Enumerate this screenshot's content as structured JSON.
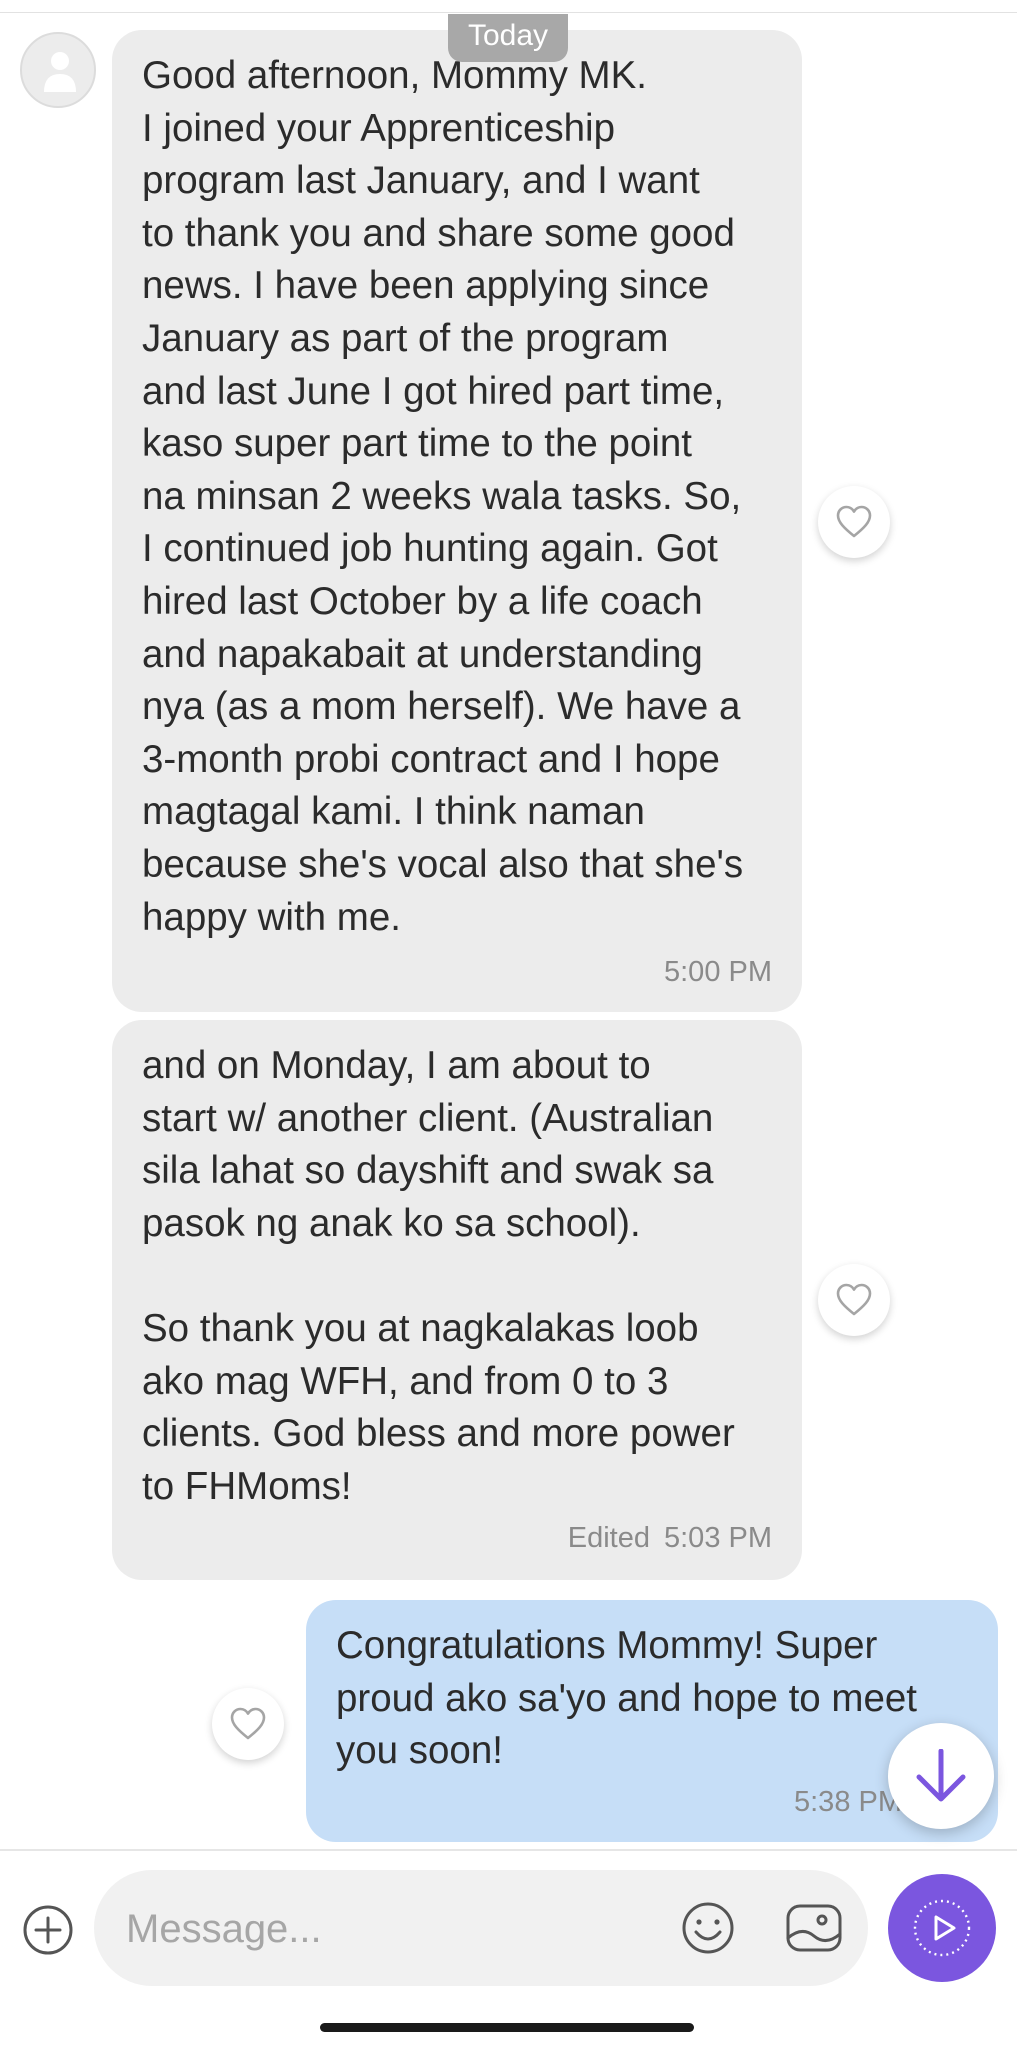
{
  "colors": {
    "incoming_bubble": "#ececec",
    "outgoing_bubble": "#c6def7",
    "accent": "#7b56df",
    "date_pill": "#a8a8a8"
  },
  "date_separator": "Today",
  "messages": [
    {
      "direction": "incoming",
      "lines": [
        "Good afternoon, Mommy MK.",
        "I joined your Apprenticeship",
        "program last January, and I want",
        "to thank you and share some good",
        "news. I have been applying since",
        "January as part of the program",
        "and last June I got hired part time,",
        "kaso super part time to the point",
        "na  minsan 2 weeks wala tasks. So,",
        "I continued job hunting again. Got",
        "hired last October by a life coach",
        "and napakabait at understanding",
        "nya (as a mom herself). We have a",
        "3-month probi contract and I hope",
        "magtagal kami. I think naman",
        "because she's vocal also that she's",
        "happy with me."
      ],
      "time": "5:00 PM",
      "edited_label": ""
    },
    {
      "direction": "incoming",
      "lines": [
        "and on Monday, I am about to",
        "start w/ another client. (Australian",
        "sila lahat so dayshift and swak sa",
        "pasok ng anak ko sa school).",
        "",
        "So thank you at nagkalakas loob",
        "ako mag WFH, and from 0 to 3",
        "clients. God bless and more power",
        "to FHMoms!"
      ],
      "time": "5:03 PM",
      "edited_label": "Edited"
    },
    {
      "direction": "outgoing",
      "lines": [
        "Congratulations Mommy! Super",
        "proud ako sa'yo and hope to meet",
        "you soon!"
      ],
      "time": "5:38 PM",
      "edited_label": ""
    }
  ],
  "composer": {
    "placeholder": "Message..."
  },
  "icons": {
    "avatar": "person-placeholder-icon",
    "reaction": "heart-outline-icon",
    "scroll": "arrow-down-icon",
    "add": "plus-circle-icon",
    "emoji": "smiley-icon",
    "photo": "photo-icon",
    "send": "play-circle-icon"
  }
}
